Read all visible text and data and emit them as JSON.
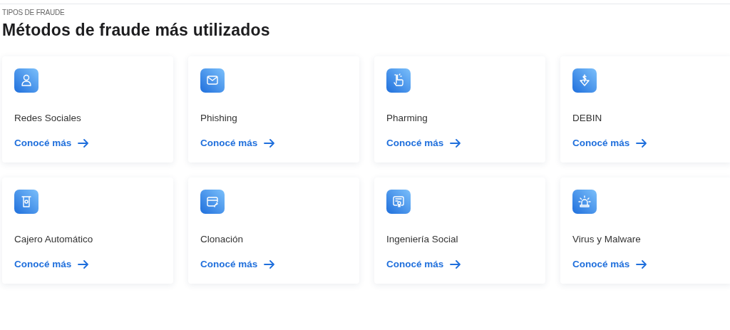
{
  "eyebrow": "TIPOS DE FRAUDE",
  "title": "Métodos de fraude más utilizados",
  "cards": [
    {
      "label": "Redes Sociales",
      "link": "Conocé más"
    },
    {
      "label": "Phishing",
      "link": "Conocé más"
    },
    {
      "label": "Pharming",
      "link": "Conocé más"
    },
    {
      "label": "DEBIN",
      "link": "Conocé más"
    },
    {
      "label": "Cajero Automático",
      "link": "Conocé más"
    },
    {
      "label": "Clonación",
      "link": "Conocé más"
    },
    {
      "label": "Ingeniería Social",
      "link": "Conocé más"
    },
    {
      "label": "Virus y Malware",
      "link": "Conocé más"
    }
  ]
}
